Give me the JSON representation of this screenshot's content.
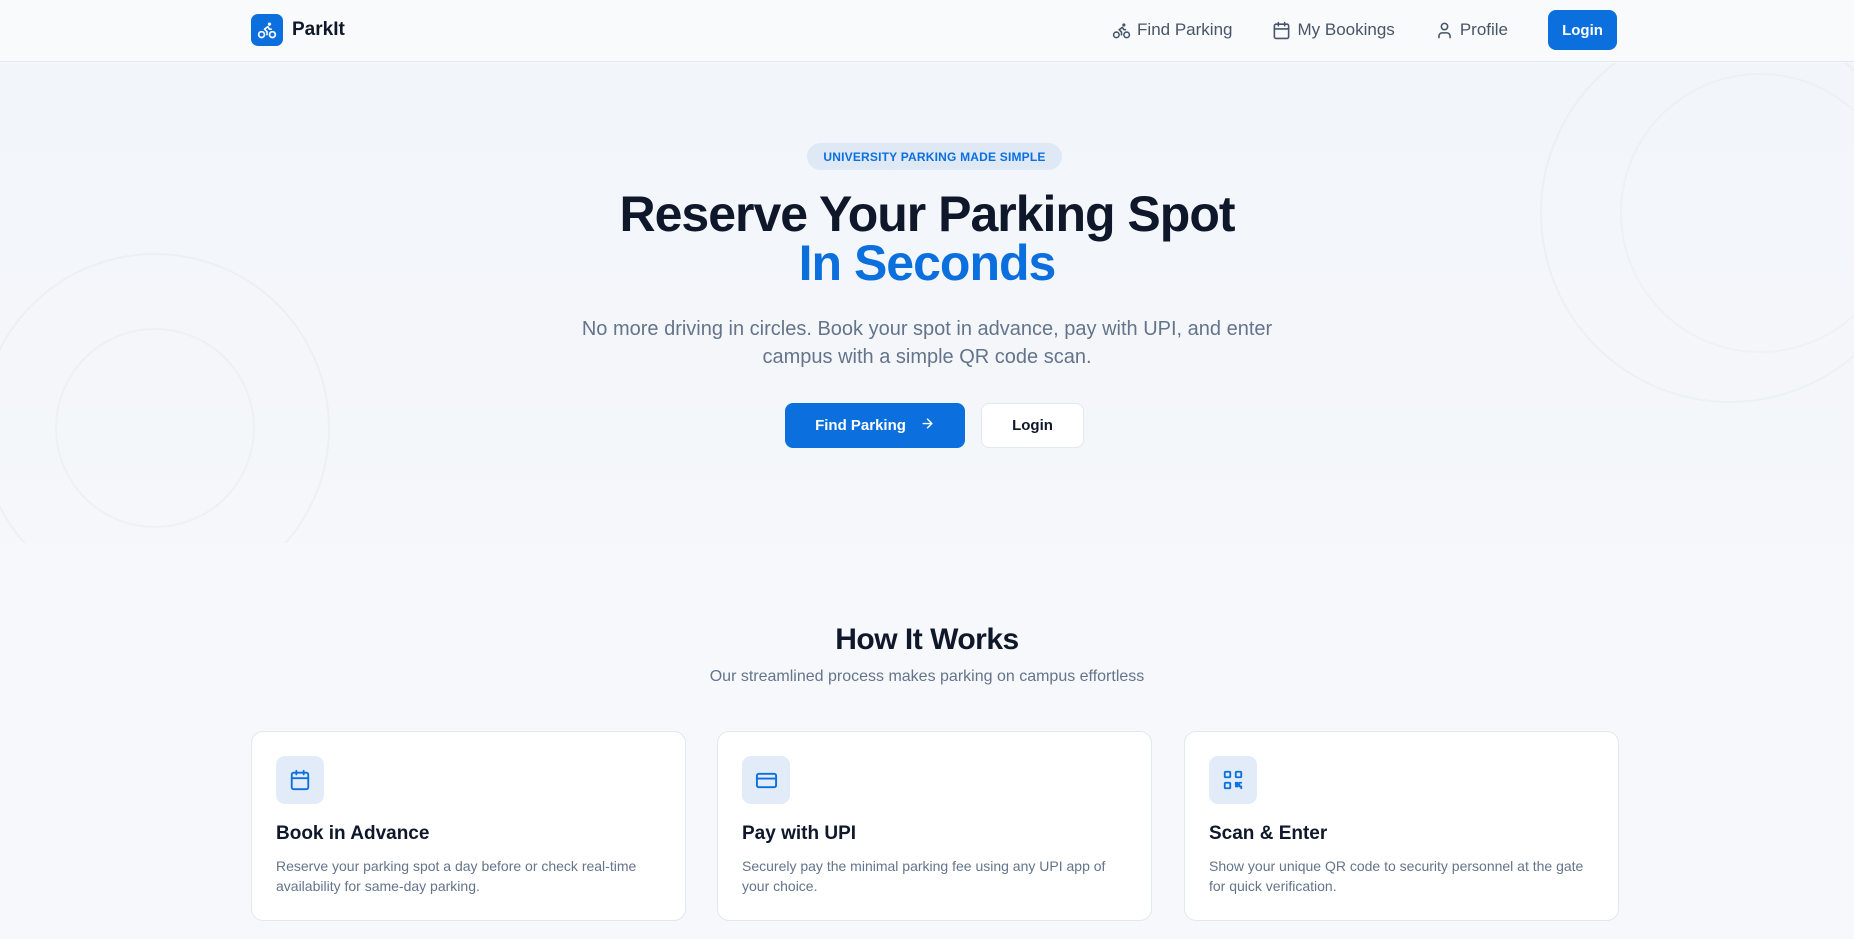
{
  "brand": {
    "name": "ParkIt",
    "icon": "bicycle-icon"
  },
  "nav": {
    "items": [
      {
        "label": "Find Parking",
        "icon": "bicycle-icon"
      },
      {
        "label": "My Bookings",
        "icon": "calendar-icon"
      },
      {
        "label": "Profile",
        "icon": "user-icon"
      }
    ],
    "login_label": "Login"
  },
  "hero": {
    "badge": "UNIVERSITY PARKING MADE SIMPLE",
    "title": "Reserve Your Parking Spot",
    "title_accent": "In Seconds",
    "subtitle": "No more driving in circles. Book your spot in advance, pay with UPI, and enter campus with a simple QR code scan.",
    "primary_button": "Find Parking",
    "secondary_button": "Login"
  },
  "how_it_works": {
    "title": "How It Works",
    "subtitle": "Our streamlined process makes parking on campus effortless",
    "cards": [
      {
        "icon": "calendar-icon",
        "title": "Book in Advance",
        "description": "Reserve your parking spot a day before or check real-time availability for same-day parking."
      },
      {
        "icon": "credit-card-icon",
        "title": "Pay with UPI",
        "description": "Securely pay the minimal parking fee using any UPI app of your choice."
      },
      {
        "icon": "qr-code-icon",
        "title": "Scan & Enter",
        "description": "Show your unique QR code to security personnel at the gate for quick verification."
      }
    ]
  },
  "colors": {
    "accent": "#0b6fde",
    "text": "#0f172a",
    "muted": "#64748b",
    "background": "#f6f8fb"
  }
}
